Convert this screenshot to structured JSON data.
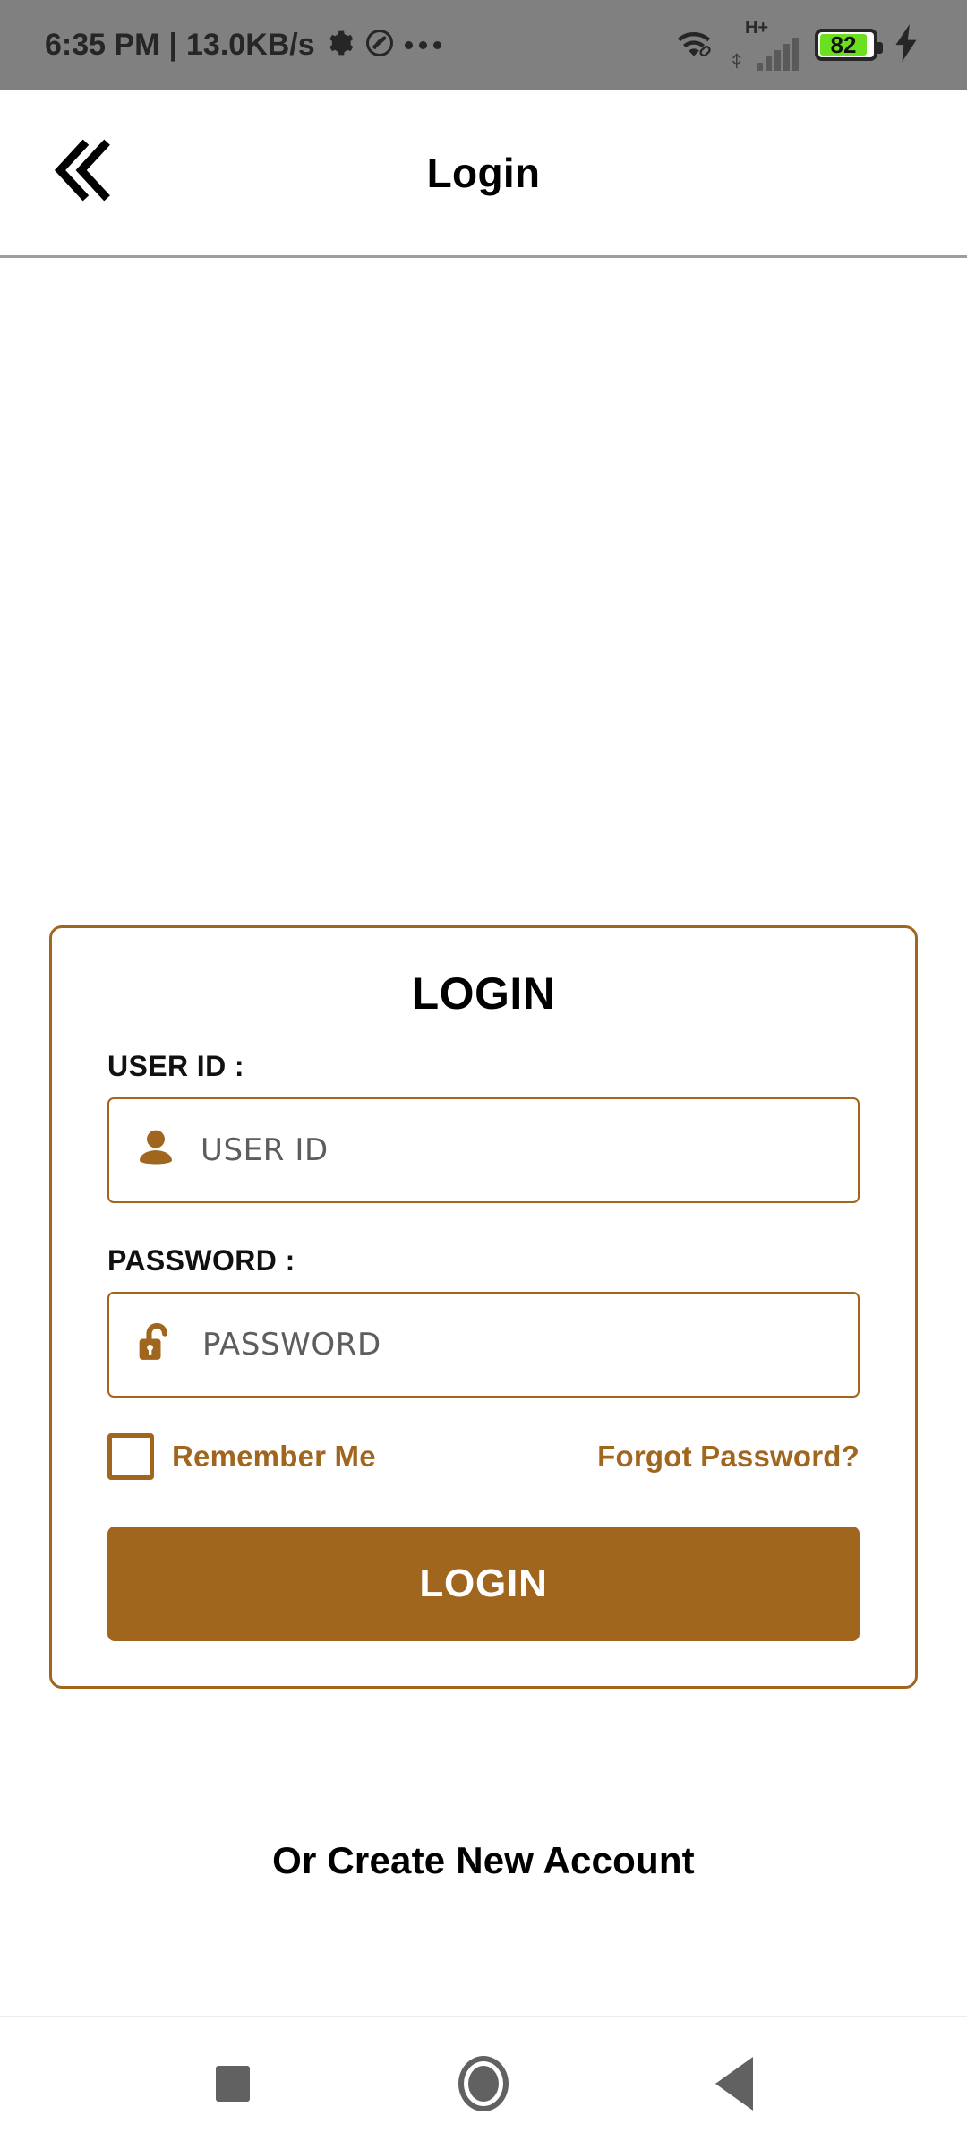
{
  "status_bar": {
    "time": "6:35 PM",
    "separator": "|",
    "network_speed": "13.0KB/s",
    "gear_icon": "gear-icon",
    "do_not_disturb_icon": "circle-slash-icon",
    "overflow_icon": "more-dots-icon",
    "wifi_icon": "wifi-icon",
    "signal_type": "H+",
    "signal_icon": "signal-bars-icon",
    "battery_level": "82",
    "charging_icon": "lightning-bolt-icon",
    "background_color": "#808080",
    "battery_fill_color": "#6ae01e"
  },
  "header": {
    "back_icon": "double-chevron-left-icon",
    "title": "Login"
  },
  "login_card": {
    "title": "LOGIN",
    "accent_color": "#a0661e",
    "user_id": {
      "label": "USER ID :",
      "placeholder": "USER ID",
      "value": "",
      "icon": "person-icon"
    },
    "password": {
      "label": "PASSWORD :",
      "placeholder": "PASSWORD",
      "value": "",
      "icon": "unlocked-padlock-icon"
    },
    "remember_me": {
      "label": "Remember Me",
      "checked": false
    },
    "forgot_password": "Forgot Password?",
    "submit_label": "LOGIN"
  },
  "create_account": "Or Create New Account",
  "nav_bar": {
    "recents_icon": "square-recents-icon",
    "home_icon": "circle-home-icon",
    "back_icon": "triangle-back-icon"
  }
}
